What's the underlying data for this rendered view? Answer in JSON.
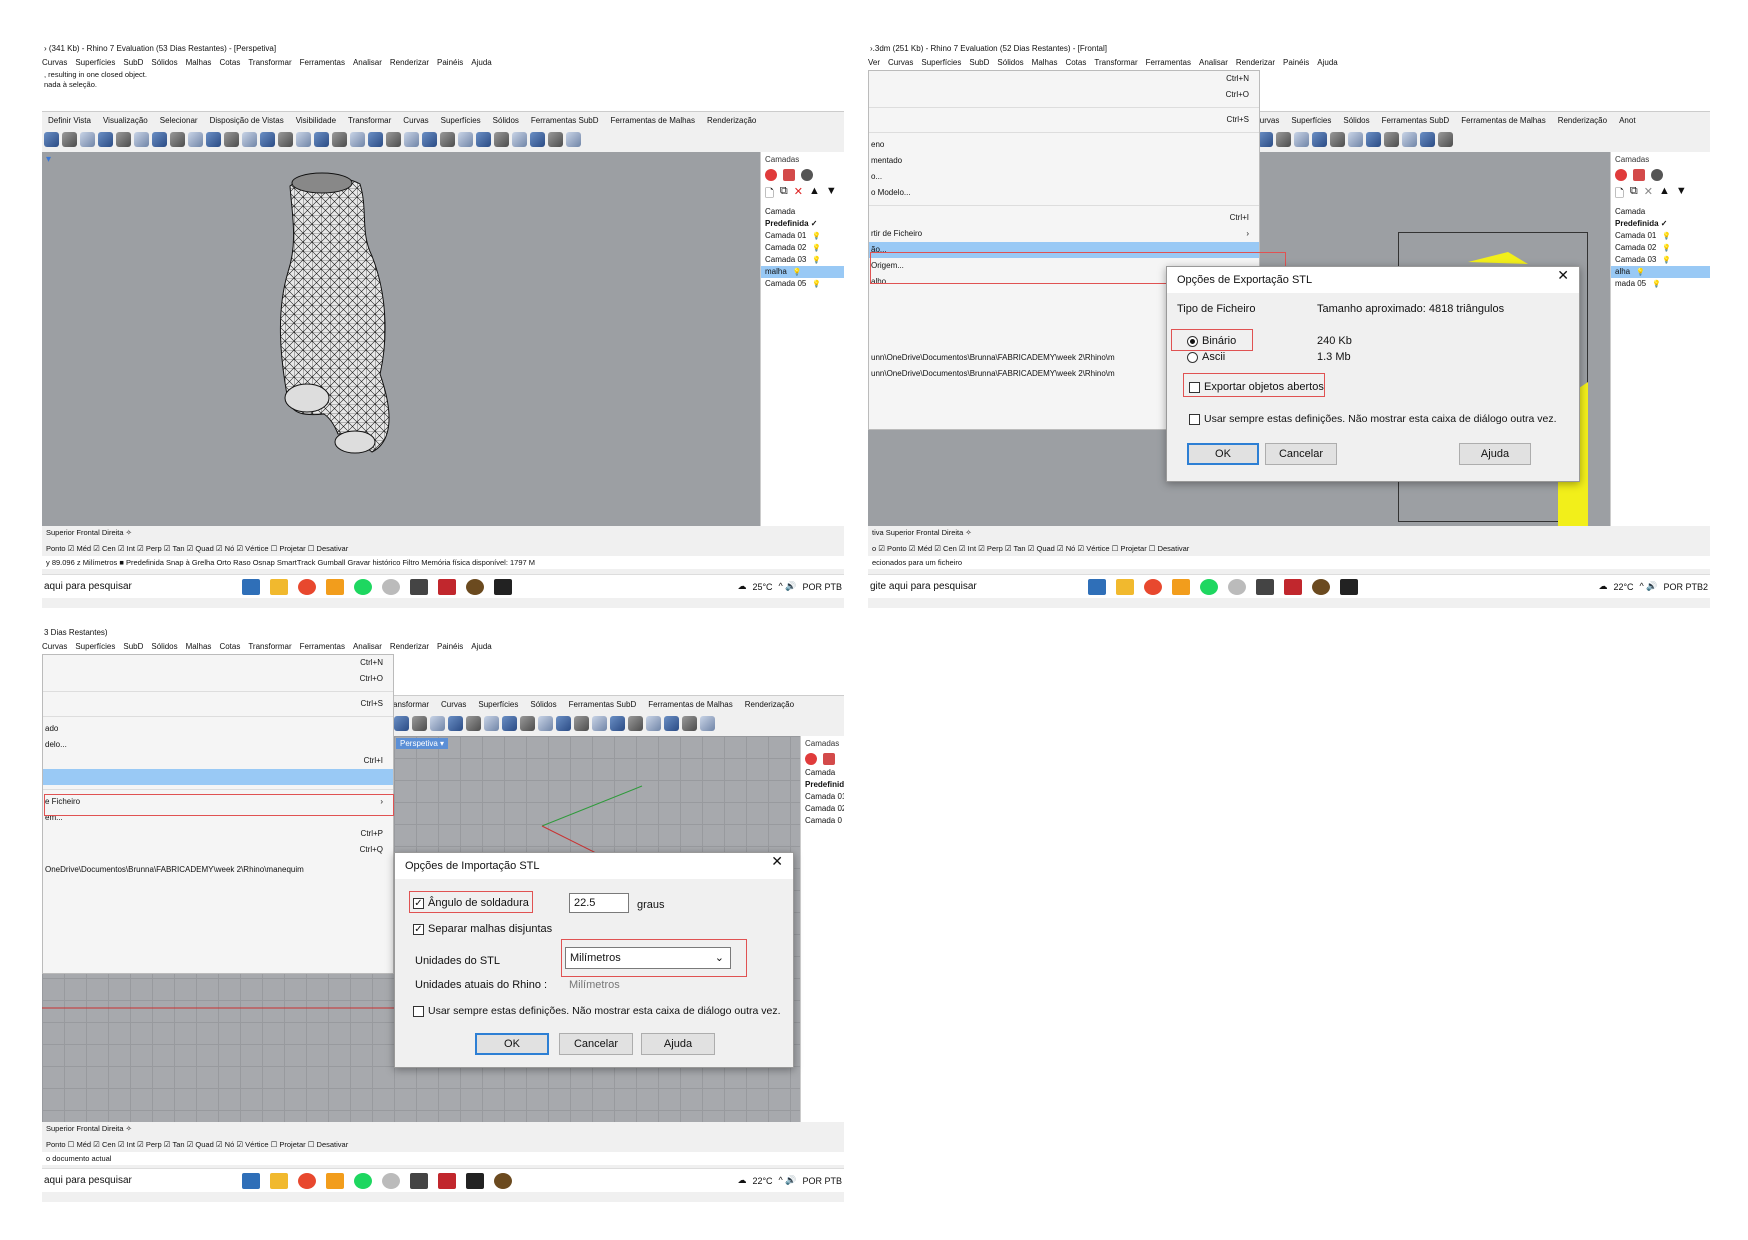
{
  "s1": {
    "title": "› (341 Kb) - Rhino 7 Evaluation (53 Dias Restantes) - [Perspetiva]",
    "menu": [
      "Curvas",
      "Superfícies",
      "SubD",
      "Sólidos",
      "Malhas",
      "Cotas",
      "Transformar",
      "Ferramentas",
      "Analisar",
      "Renderizar",
      "Painéis",
      "Ajuda"
    ],
    "cmd_lines": [
      ", resulting in one closed object.",
      "nada à seleção."
    ],
    "tabs": [
      "Definir Vista",
      "Visualização",
      "Selecionar",
      "Disposição de Vistas",
      "Visibilidade",
      "Transformar",
      "Curvas",
      "Superfícies",
      "Sólidos",
      "Ferramentas SubD",
      "Ferramentas de Malhas",
      "Renderização"
    ],
    "panel_title": "Camadas",
    "layer_header": "Camada",
    "layers": [
      "Predefinida ✓",
      "Camada 01",
      "Camada 02",
      "Camada 03",
      "malha",
      "Camada 05"
    ],
    "view_tabs": "Superior   Frontal   Direita   ✧",
    "osnap": "Ponto ☑ Méd ☑ Cen ☑ Int ☑ Perp ☑ Tan ☑ Quad ☑ Nó ☑ Vértice ☐ Projetar ☐ Desativar",
    "status": "y 89.096         z          Milímetros     ■ Predefinida                         Snap à Grelha  Orto  Raso  Osnap  SmartTrack  Gumball  Gravar histórico  Filtro  Memória física disponível: 1797 M",
    "search": "aqui para pesquisar",
    "weather": "25°C",
    "lang": "POR PTB"
  },
  "s2": {
    "title": "›.3dm (251 Kb) - Rhino 7 Evaluation (52 Dias Restantes) - [Frontal]",
    "menu": [
      "Ver",
      "Curvas",
      "Superfícies",
      "SubD",
      "Sólidos",
      "Malhas",
      "Cotas",
      "Transformar",
      "Ferramentas",
      "Analisar",
      "Renderizar",
      "Painéis",
      "Ajuda"
    ],
    "tabs": [
      "Curvas",
      "Superfícies",
      "Sólidos",
      "Ferramentas SubD",
      "Ferramentas de Malhas",
      "Renderização",
      "Anot"
    ],
    "menu_items": [
      {
        "label": "",
        "sc": "Ctrl+N"
      },
      {
        "label": "",
        "sc": "Ctrl+O"
      },
      {
        "label": "",
        "sc": "Ctrl+S"
      },
      {
        "label": "eno",
        "sc": ""
      },
      {
        "label": "mentado",
        "sc": ""
      },
      {
        "label": "o...",
        "sc": ""
      },
      {
        "label": "o Modelo...",
        "sc": ""
      },
      {
        "label": "",
        "sc": "Ctrl+I"
      },
      {
        "label": "rtir de Ficheiro",
        "sc": "›"
      },
      {
        "label": "ão...",
        "sc": ""
      },
      {
        "label": "Origem...",
        "sc": ""
      },
      {
        "label": "alho",
        "sc": ""
      }
    ],
    "recent1": "unn\\OneDrive\\Documentos\\Brunna\\FABRICADEMY\\week 2\\Rhino\\m",
    "recent2": "unn\\OneDrive\\Documentos\\Brunna\\FABRICADEMY\\week 2\\Rhino\\m",
    "panel_title": "Camadas",
    "layer_header": "Camada",
    "layers": [
      "Predefinida ✓",
      "Camada 01",
      "Camada 02",
      "Camada 03",
      "alha",
      "mada 05"
    ],
    "dialog": {
      "title": "Opções de Exportação STL",
      "file_type_label": "Tipo de Ficheiro",
      "size_label": "Tamanho aproximado: 4818 triângulos",
      "binary": "Binário",
      "binary_size": "240 Kb",
      "ascii": "Ascii",
      "ascii_size": "1.3 Mb",
      "export_open": "Exportar objetos abertos",
      "always_use": "Usar sempre estas definições. Não mostrar esta caixa de diálogo outra vez.",
      "ok": "OK",
      "cancel": "Cancelar",
      "help": "Ajuda"
    },
    "view_tabs": "tiva   Superior   Frontal   Direita   ✧",
    "osnap": "o ☑ Ponto ☑ Méd ☑ Cen ☑ Int ☑ Perp ☑ Tan ☑ Quad ☑ Nó ☑ Vértice ☐ Projetar ☐ Desativar",
    "status": "ecionados para um ficheiro",
    "search": "gite aqui para pesquisar",
    "weather": "22°C",
    "lang": "POR PTB2"
  },
  "s3": {
    "title": "3 Dias Restantes)",
    "menu": [
      "Curvas",
      "Superfícies",
      "SubD",
      "Sólidos",
      "Malhas",
      "Cotas",
      "Transformar",
      "Ferramentas",
      "Analisar",
      "Renderizar",
      "Painéis",
      "Ajuda"
    ],
    "tabs": [
      "ansformar",
      "Curvas",
      "Superfícies",
      "Sólidos",
      "Ferramentas SubD",
      "Ferramentas de Malhas",
      "Renderização"
    ],
    "menu_items": [
      {
        "label": "",
        "sc": "Ctrl+N"
      },
      {
        "label": "",
        "sc": "Ctrl+O"
      },
      {
        "label": "",
        "sc": "Ctrl+S"
      },
      {
        "label": "ado",
        "sc": ""
      },
      {
        "label": "delo...",
        "sc": ""
      },
      {
        "label": "",
        "sc": "Ctrl+I"
      },
      {
        "label": "",
        "sc": ""
      },
      {
        "label": "e Ficheiro",
        "sc": "›"
      },
      {
        "label": "em...",
        "sc": ""
      },
      {
        "label": "",
        "sc": "Ctrl+P"
      },
      {
        "label": "",
        "sc": "Ctrl+Q"
      }
    ],
    "recent": "OneDrive\\Documentos\\Brunna\\FABRICADEMY\\week 2\\Rhino\\manequim",
    "viewport_label": "Perspetiva ▾",
    "panel_title": "Camadas",
    "layer_header": "Camada",
    "layers": [
      "Predefinid",
      "Camada 01",
      "Camada 02",
      "Camada 0"
    ],
    "dialog": {
      "title": "Opções de Importação STL",
      "weld_label": "Ângulo de soldadura",
      "weld_value": "22.5",
      "weld_unit": "graus",
      "split_label": "Separar malhas disjuntas",
      "units_label": "Unidades do STL",
      "units_value": "Milímetros",
      "current_label": "Unidades atuais do Rhino :",
      "current_value": "Milímetros",
      "always_use": "Usar sempre estas definições. Não mostrar esta caixa de diálogo outra vez.",
      "ok": "OK",
      "cancel": "Cancelar",
      "help": "Ajuda"
    },
    "view_tabs": "Superior   Frontal   Direita   ✧",
    "osnap": "Ponto ☐ Méd ☑ Cen ☑ Int ☑ Perp ☑ Tan ☑ Quad ☑ Nó ☑ Vértice ☐ Projetar ☐ Desativar",
    "status": "o documento actual",
    "search": "aqui para pesquisar",
    "weather": "22°C",
    "lang": "POR PTB"
  },
  "colors": {
    "highlight": "#99c9f5",
    "redbox": "#e05252",
    "yellow_mesh": "#f2ef1a"
  }
}
